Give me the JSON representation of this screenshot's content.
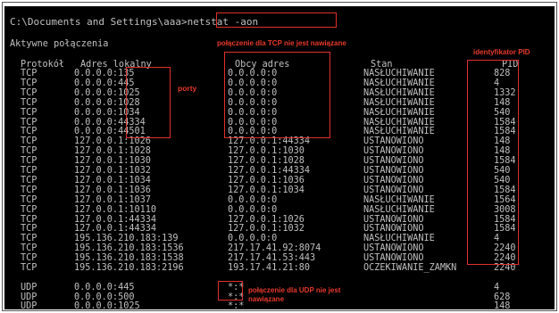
{
  "command_line": "C:\\Documents and Settings\\aaa>netstat -aon",
  "section_title": "Aktywne połączenia",
  "headers": {
    "protocol": "Protokół",
    "local": "Adres lokalny",
    "foreign": "Obcy adres",
    "state": "Stan",
    "pid": "PID"
  },
  "rows": [
    {
      "proto": "TCP",
      "local": "0.0.0.0:135",
      "foreign": "0.0.0.0:0",
      "state": "NASŁUCHIWANIE",
      "pid": "828"
    },
    {
      "proto": "TCP",
      "local": "0.0.0.0:445",
      "foreign": "0.0.0.0:0",
      "state": "NASŁUCHIWANIE",
      "pid": "4"
    },
    {
      "proto": "TCP",
      "local": "0.0.0.0:1025",
      "foreign": "0.0.0.0:0",
      "state": "NASŁUCHIWANIE",
      "pid": "1332"
    },
    {
      "proto": "TCP",
      "local": "0.0.0.0:1028",
      "foreign": "0.0.0.0:0",
      "state": "NASŁUCHIWANIE",
      "pid": "148"
    },
    {
      "proto": "TCP",
      "local": "0.0.0.0:1034",
      "foreign": "0.0.0.0:0",
      "state": "NASŁUCHIWANIE",
      "pid": "540"
    },
    {
      "proto": "TCP",
      "local": "0.0.0.0:44334",
      "foreign": "0.0.0.0:0",
      "state": "NASŁUCHIWANIE",
      "pid": "1584"
    },
    {
      "proto": "TCP",
      "local": "0.0.0.0:44501",
      "foreign": "0.0.0.0:0",
      "state": "NASŁUCHIWANIE",
      "pid": "1584"
    },
    {
      "proto": "TCP",
      "local": "127.0.0.1:1026",
      "foreign": "127.0.0.1:44334",
      "state": "USTANOWIONO",
      "pid": "148"
    },
    {
      "proto": "TCP",
      "local": "127.0.0.1:1028",
      "foreign": "127.0.0.1:1030",
      "state": "USTANOWIONO",
      "pid": "148"
    },
    {
      "proto": "TCP",
      "local": "127.0.0.1:1030",
      "foreign": "127.0.0.1:1028",
      "state": "USTANOWIONO",
      "pid": "1584"
    },
    {
      "proto": "TCP",
      "local": "127.0.0.1:1032",
      "foreign": "127.0.0.1:44334",
      "state": "USTANOWIONO",
      "pid": "540"
    },
    {
      "proto": "TCP",
      "local": "127.0.0.1:1034",
      "foreign": "127.0.0.1:1036",
      "state": "USTANOWIONO",
      "pid": "540"
    },
    {
      "proto": "TCP",
      "local": "127.0.0.1:1036",
      "foreign": "127.0.0.1:1034",
      "state": "USTANOWIONO",
      "pid": "1584"
    },
    {
      "proto": "TCP",
      "local": "127.0.0.1:1037",
      "foreign": "0.0.0.0:0",
      "state": "NASŁUCHIWANIE",
      "pid": "1564"
    },
    {
      "proto": "TCP",
      "local": "127.0.0.1:10110",
      "foreign": "0.0.0.0:0",
      "state": "NASŁUCHIWANIE",
      "pid": "3008"
    },
    {
      "proto": "TCP",
      "local": "127.0.0.1:44334",
      "foreign": "127.0.0.1:1026",
      "state": "USTANOWIONO",
      "pid": "1584"
    },
    {
      "proto": "TCP",
      "local": "127.0.0.1:44334",
      "foreign": "127.0.0.1:1032",
      "state": "USTANOWIONO",
      "pid": "1584"
    },
    {
      "proto": "TCP",
      "local": "195.136.210.183:139",
      "foreign": "0.0.0.0:0",
      "state": "NASŁUCHIWANIE",
      "pid": "4"
    },
    {
      "proto": "TCP",
      "local": "195.136.210.183:1536",
      "foreign": "217.17.41.92:8074",
      "state": "USTANOWIONO",
      "pid": "2240"
    },
    {
      "proto": "TCP",
      "local": "195.136.210.183:1538",
      "foreign": "217.17.41.53:443",
      "state": "USTANOWIONO",
      "pid": "2240"
    },
    {
      "proto": "TCP",
      "local": "195.136.210.183:2196",
      "foreign": "193.17.41.21:80",
      "state": "OCZEKIWANIE_ZAMKN",
      "pid": "2240"
    }
  ],
  "udp_rows": [
    {
      "proto": "UDP",
      "local": "0.0.0.0:445",
      "foreign": "*:*",
      "state": "",
      "pid": "4"
    },
    {
      "proto": "UDP",
      "local": "0.0.0.0:500",
      "foreign": "*:*",
      "state": "",
      "pid": "628"
    },
    {
      "proto": "UDP",
      "local": "0.0.0.0:1025",
      "foreign": "*:*",
      "state": "",
      "pid": "148"
    }
  ],
  "annotations": {
    "tcp_note": "połączenie dla TCP nie jest nawiązane",
    "pid_note": "identyfikator PID",
    "ports_note": "porty",
    "udp_note": "połączenie dla UDP nie jest\nnawiązane"
  },
  "colors": {
    "console_bg": "#000000",
    "console_text": "#c0c0c0",
    "annotation": "#e0302c"
  }
}
